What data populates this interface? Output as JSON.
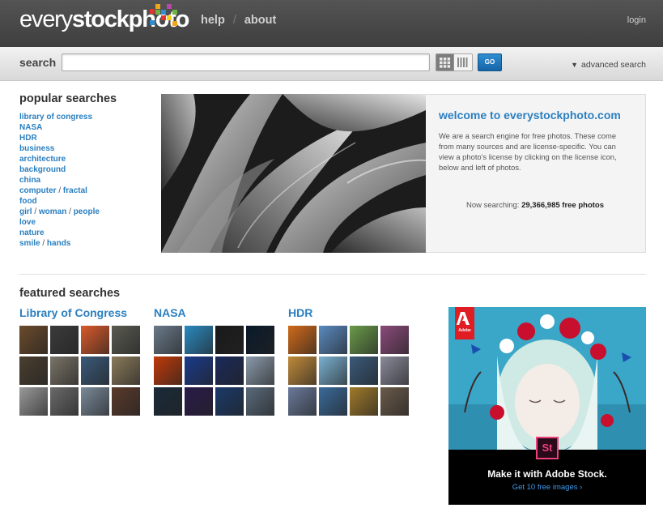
{
  "header": {
    "logo_light": "every",
    "logo_bold": "stockphoto",
    "nav": [
      {
        "label": "help"
      },
      {
        "label": "about"
      }
    ],
    "login": "login"
  },
  "search": {
    "label": "search",
    "value": "",
    "go_label": "GO",
    "advanced_label": "advanced search"
  },
  "popular": {
    "title": "popular searches",
    "items": [
      {
        "terms": [
          "library of congress"
        ]
      },
      {
        "terms": [
          "NASA"
        ]
      },
      {
        "terms": [
          "HDR"
        ]
      },
      {
        "terms": [
          "business"
        ]
      },
      {
        "terms": [
          "architecture"
        ]
      },
      {
        "terms": [
          "background"
        ]
      },
      {
        "terms": [
          "china"
        ]
      },
      {
        "terms": [
          "computer",
          "fractal"
        ]
      },
      {
        "terms": [
          "food"
        ]
      },
      {
        "terms": [
          "girl",
          "woman",
          "people"
        ]
      },
      {
        "terms": [
          "love"
        ]
      },
      {
        "terms": [
          "nature"
        ]
      },
      {
        "terms": [
          "smile",
          "hands"
        ]
      }
    ]
  },
  "welcome": {
    "title": "welcome to everystockphoto.com",
    "text": "We are a search engine for free photos. These come from many sources and are license-specific. You can view a photo's license by clicking on the license icon, below and left of photos.",
    "searching_prefix": "Now searching: ",
    "searching_count": "29,366,985 free photos"
  },
  "featured": {
    "title": "featured searches",
    "columns": [
      {
        "title": "Library of Congress",
        "thumbs": [
          "#6b4a2a",
          "#3b3b3b",
          "#d95a2a",
          "#5a5a52",
          "#4a3e30",
          "#7a7468",
          "#3a5a7a",
          "#8a7a5a",
          "#9a9a9a",
          "#6a6a6a",
          "#7a8a9a",
          "#5a3a2a"
        ]
      },
      {
        "title": "NASA",
        "thumbs": [
          "#6a7a8a",
          "#2a8ac0",
          "#1a1a1a",
          "#0a1a2a",
          "#c03a0a",
          "#1a3a8a",
          "#1a2a5a",
          "#8a9aaa",
          "#1a2a3a",
          "#2a1a4a",
          "#1a3a6a",
          "#5a6a7a"
        ]
      },
      {
        "title": "HDR",
        "thumbs": [
          "#d06a1a",
          "#5a8ac0",
          "#6a9a4a",
          "#8a4a7a",
          "#c08a3a",
          "#7ab0d0",
          "#3a5a7a",
          "#8a8a9a",
          "#6a7a9a",
          "#3a6a9a",
          "#a07a2a",
          "#6a5a4a"
        ]
      }
    ]
  },
  "ad": {
    "brand": "Adobe",
    "badge": "St",
    "headline": "Make it with Adobe Stock.",
    "cta": "Get 10 free images ›"
  }
}
